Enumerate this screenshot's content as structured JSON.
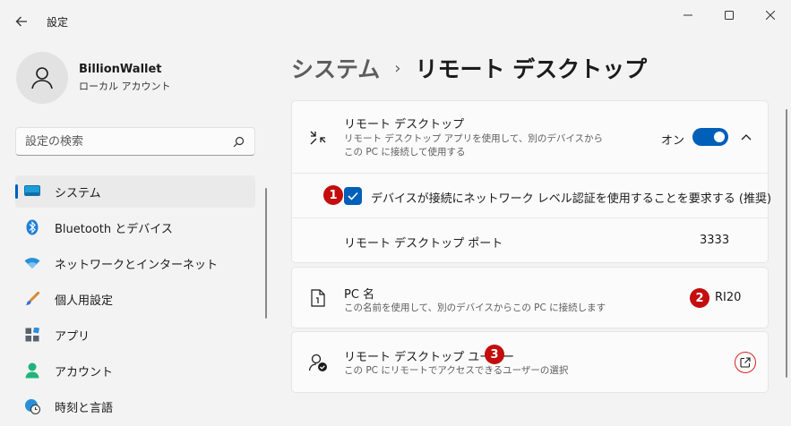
{
  "window": {
    "title": "設定",
    "minimize": "—",
    "maximize": "☐",
    "close": "✕"
  },
  "profile": {
    "name": "BillionWallet",
    "account_type": "ローカル アカウント"
  },
  "search": {
    "placeholder": "設定の検索"
  },
  "sidebar": {
    "items": [
      {
        "label": "システム",
        "icon": "monitor-icon",
        "active": true
      },
      {
        "label": "Bluetooth とデバイス",
        "icon": "bluetooth-icon"
      },
      {
        "label": "ネットワークとインターネット",
        "icon": "wifi-icon"
      },
      {
        "label": "個人用設定",
        "icon": "brush-icon"
      },
      {
        "label": "アプリ",
        "icon": "apps-icon"
      },
      {
        "label": "アカウント",
        "icon": "person-icon"
      },
      {
        "label": "時刻と言語",
        "icon": "globe-clock-icon"
      }
    ]
  },
  "breadcrumb": {
    "parent": "システム",
    "separator": "›",
    "current": "リモート デスクトップ"
  },
  "remote_desktop": {
    "title": "リモート デスクトップ",
    "desc_line1": "リモート デスクトップ アプリを使用して、別のデバイスから",
    "desc_line2": "この PC に接続して使用する",
    "toggle_state": "オン",
    "toggle_on": true,
    "nla_label": "デバイスが接続にネットワーク レベル認証を使用することを要求する (推奨)",
    "nla_checked": true,
    "port_label": "リモート デスクトップ ポート",
    "port_value": "3333"
  },
  "pc_name": {
    "title": "PC 名",
    "desc": "この名前を使用して、別のデバイスからこの PC に接続します",
    "value": "RI20"
  },
  "users": {
    "title": "リモート デスクトップ ユーザー",
    "desc": "この PC にリモートでアクセスできるユーザーの選択"
  },
  "badges": {
    "one": "1",
    "two": "2",
    "three": "3"
  },
  "colors": {
    "accent": "#005fb8",
    "badge": "#c40d0d",
    "background": "#f3f3f3",
    "card": "#fbfbfb"
  }
}
